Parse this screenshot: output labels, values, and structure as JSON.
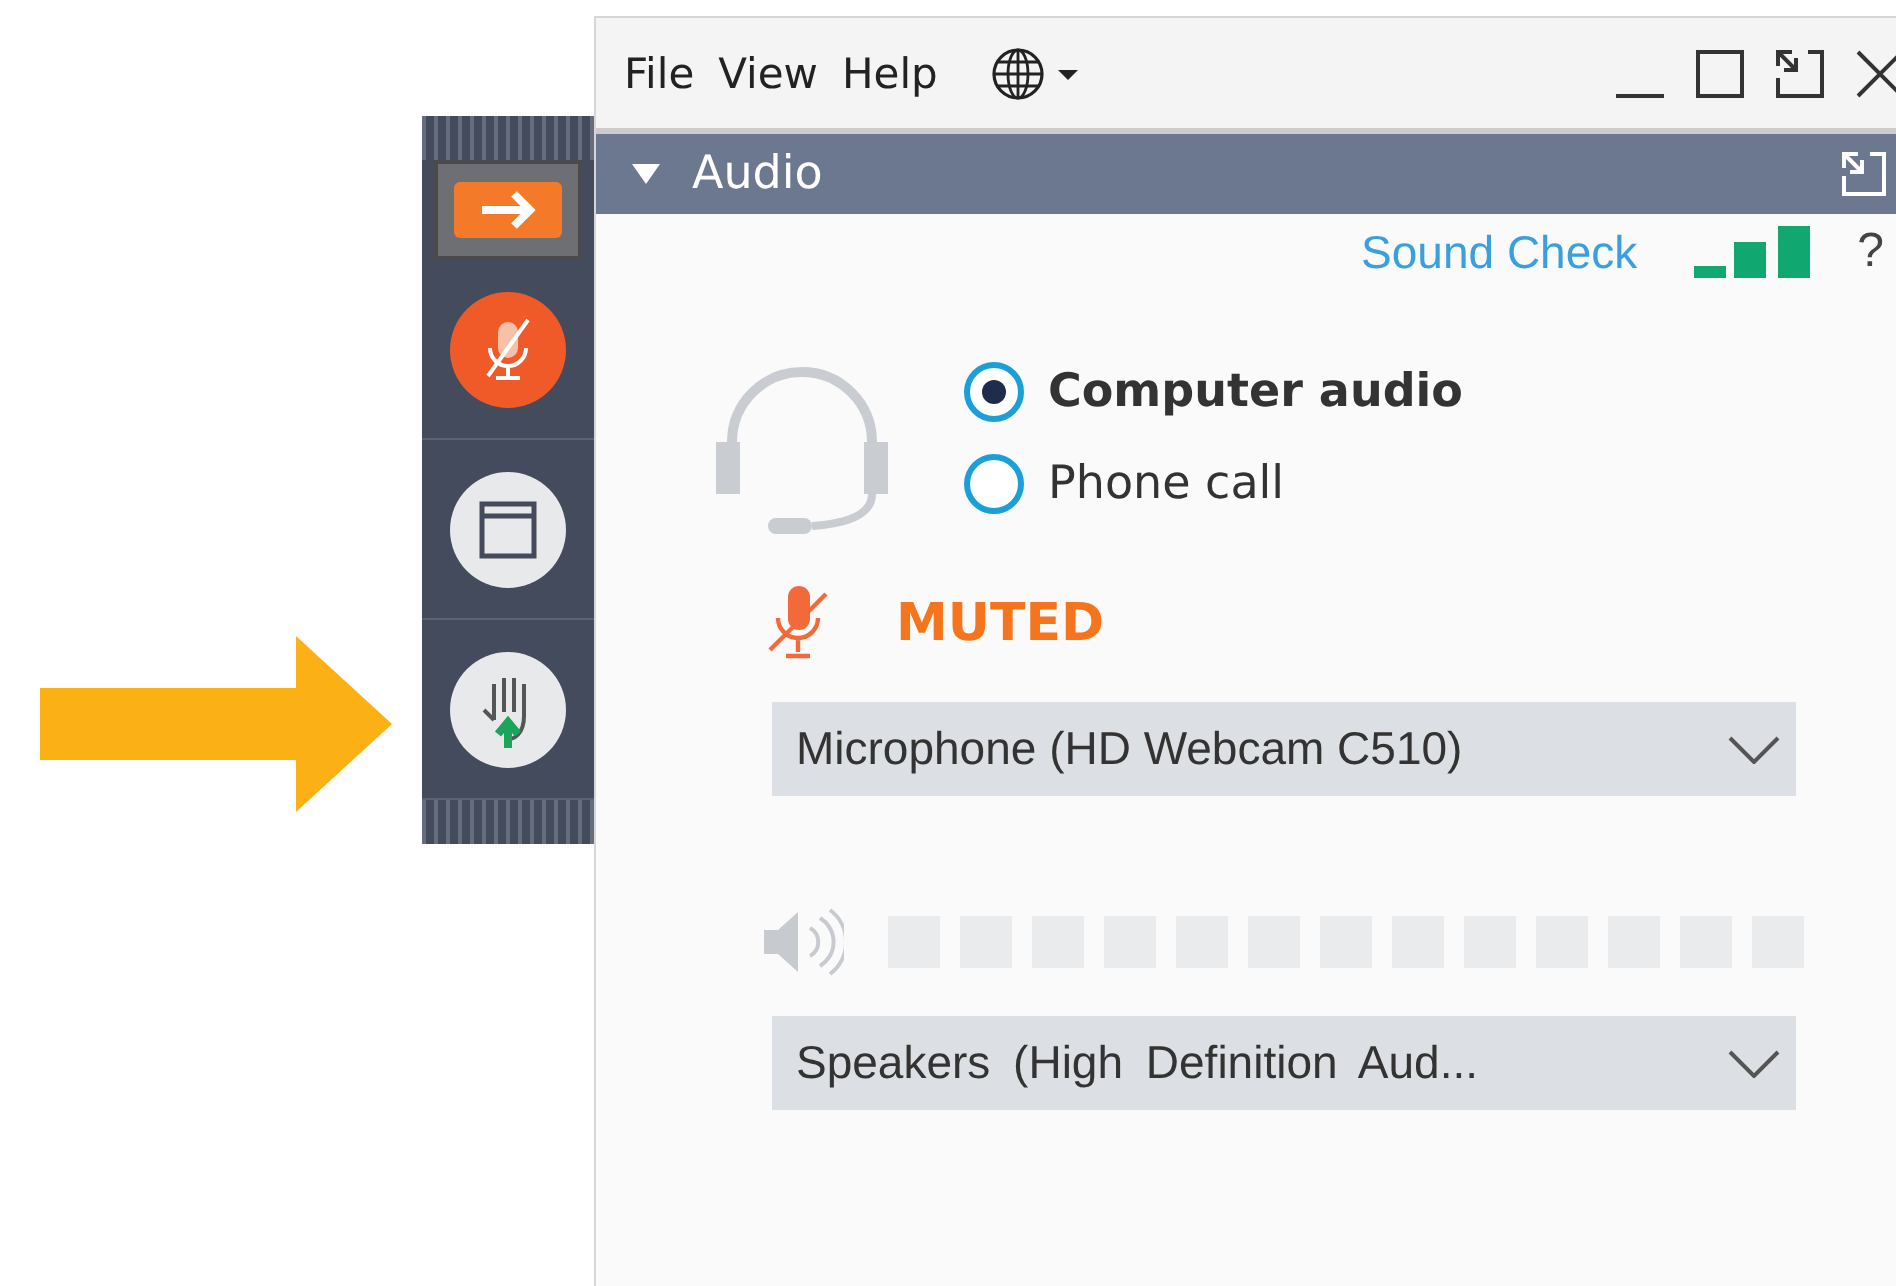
{
  "menu": [
    "File",
    "View",
    "Help"
  ],
  "toolbar": [
    {
      "kind": "collapse"
    },
    {
      "kind": "mute"
    },
    {
      "kind": "window"
    },
    {
      "kind": "hand"
    }
  ],
  "audio_panel": {
    "title": "Audio",
    "expanded": true,
    "sound_check": "Sound Check",
    "help": "?",
    "options": [
      {
        "label": "Computer audio",
        "selected": true
      },
      {
        "label": "Phone call",
        "selected": false
      }
    ],
    "mic_status": {
      "muted": true,
      "label": "MUTED"
    },
    "microphone": {
      "value": "Microphone (HD Webcam C510)"
    },
    "speakers": {
      "value": "Speakers (High Definition Aud..."
    }
  }
}
